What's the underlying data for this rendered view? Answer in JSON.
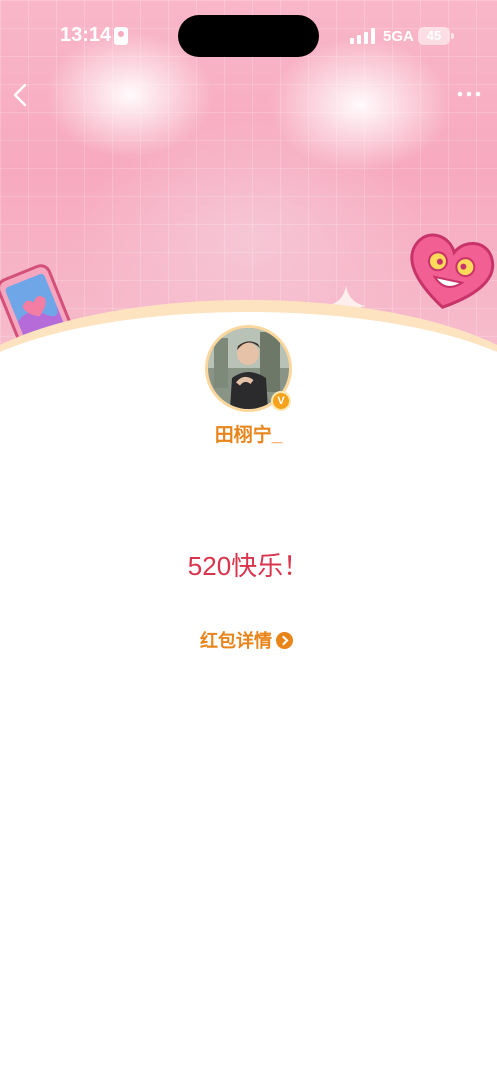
{
  "status_bar": {
    "time": "13:14",
    "network": "5GA",
    "battery": "45"
  },
  "nav": {
    "back_icon": "chevron-left-icon",
    "more_icon": "more-dots-icon"
  },
  "sender": {
    "name": "田栩宁_",
    "verified_badge": "V"
  },
  "message": "520快乐！",
  "detail_link": {
    "label": "红包详情",
    "icon": "chevron-right-circle-icon"
  },
  "colors": {
    "accent": "#e8841a",
    "message": "#d8344c",
    "header_pink": "#f7a9bf"
  }
}
